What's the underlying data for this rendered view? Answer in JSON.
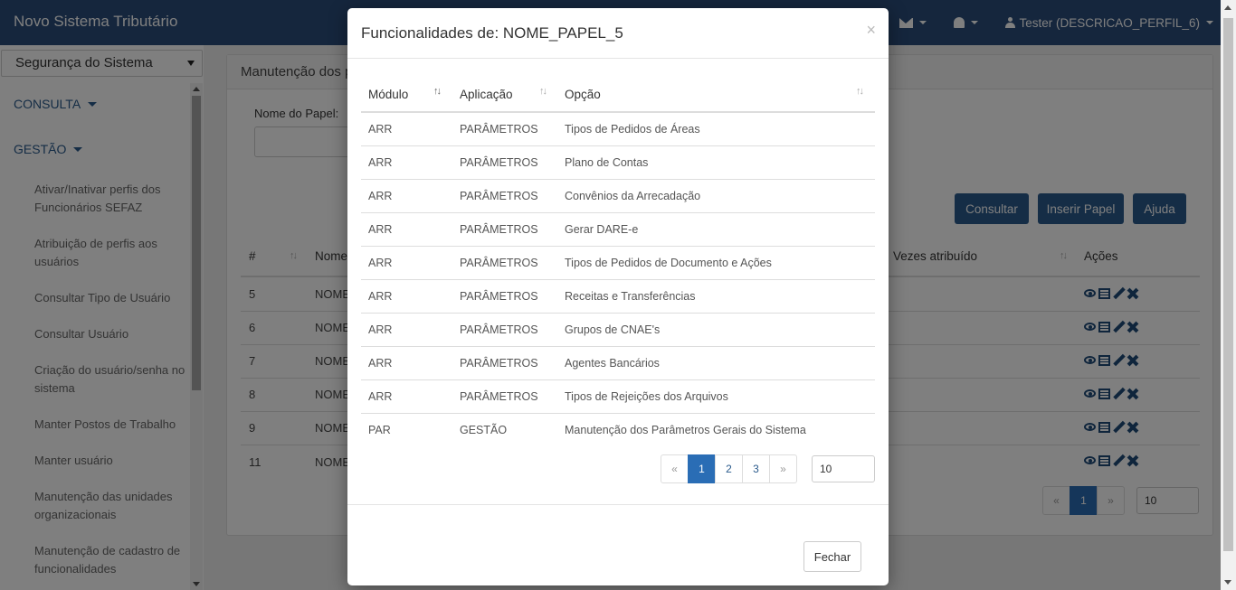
{
  "navbar": {
    "brand": "Novo Sistema Tributário",
    "user_label": "Tester (DESCRICAO_PERFIL_6)"
  },
  "sidebar": {
    "system_select": "Segurança do Sistema",
    "sections": [
      {
        "label": "CONSULTA"
      },
      {
        "label": "GESTÃO"
      }
    ],
    "items": [
      {
        "label": "Ativar/Inativar perfis dos Funcionários SEFAZ"
      },
      {
        "label": "Atribuição de perfis aos usuários"
      },
      {
        "label": "Consultar Tipo de Usuário"
      },
      {
        "label": "Consultar Usuário"
      },
      {
        "label": "Criação do usuário/senha no sistema"
      },
      {
        "label": "Manter Postos de Trabalho"
      },
      {
        "label": "Manter usuário"
      },
      {
        "label": "Manutenção das unidades organizacionais"
      },
      {
        "label": "Manutenção de cadastro de funcionalidades"
      }
    ]
  },
  "main": {
    "panel_title": "Manutenção dos p",
    "field_label": "Nome do Papel:",
    "buttons": {
      "consultar": "Consultar",
      "inserir": "Inserir Papel",
      "ajuda": "Ajuda"
    },
    "columns": {
      "num": "#",
      "nome": "Nome",
      "vezes": "Vezes atribuído",
      "acoes": "Ações"
    },
    "rows": [
      {
        "num": "5",
        "nome": "NOME"
      },
      {
        "num": "6",
        "nome": "NOME"
      },
      {
        "num": "7",
        "nome": "NOME"
      },
      {
        "num": "8",
        "nome": "NOME"
      },
      {
        "num": "9",
        "nome": "NOME"
      },
      {
        "num": "11",
        "nome": "NOME"
      }
    ],
    "pager": {
      "prev": "«",
      "current": "1",
      "next": "»"
    },
    "page_size": "10"
  },
  "modal": {
    "title": "Funcionalidades de: NOME_PAPEL_5",
    "close": "×",
    "columns": {
      "modulo": "Módulo",
      "aplicacao": "Aplicação",
      "opcao": "Opção"
    },
    "rows": [
      {
        "modulo": "ARR",
        "aplicacao": "PARÂMETROS",
        "opcao": "Tipos de Pedidos de Áreas"
      },
      {
        "modulo": "ARR",
        "aplicacao": "PARÂMETROS",
        "opcao": "Plano de Contas"
      },
      {
        "modulo": "ARR",
        "aplicacao": "PARÂMETROS",
        "opcao": "Convênios da Arrecadação"
      },
      {
        "modulo": "ARR",
        "aplicacao": "PARÂMETROS",
        "opcao": "Gerar DARE-e"
      },
      {
        "modulo": "ARR",
        "aplicacao": "PARÂMETROS",
        "opcao": "Tipos de Pedidos de Documento e Ações"
      },
      {
        "modulo": "ARR",
        "aplicacao": "PARÂMETROS",
        "opcao": "Receitas e Transferências"
      },
      {
        "modulo": "ARR",
        "aplicacao": "PARÂMETROS",
        "opcao": "Grupos de CNAE's"
      },
      {
        "modulo": "ARR",
        "aplicacao": "PARÂMETROS",
        "opcao": "Agentes Bancários"
      },
      {
        "modulo": "ARR",
        "aplicacao": "PARÂMETROS",
        "opcao": "Tipos de Rejeições dos Arquivos"
      },
      {
        "modulo": "PAR",
        "aplicacao": "GESTÃO",
        "opcao": "Manutenção dos Parâmetros Gerais do Sistema"
      }
    ],
    "pager": {
      "prev": "«",
      "pages": [
        "1",
        "2",
        "3"
      ],
      "next": "»"
    },
    "page_size": "10",
    "close_button": "Fechar"
  }
}
